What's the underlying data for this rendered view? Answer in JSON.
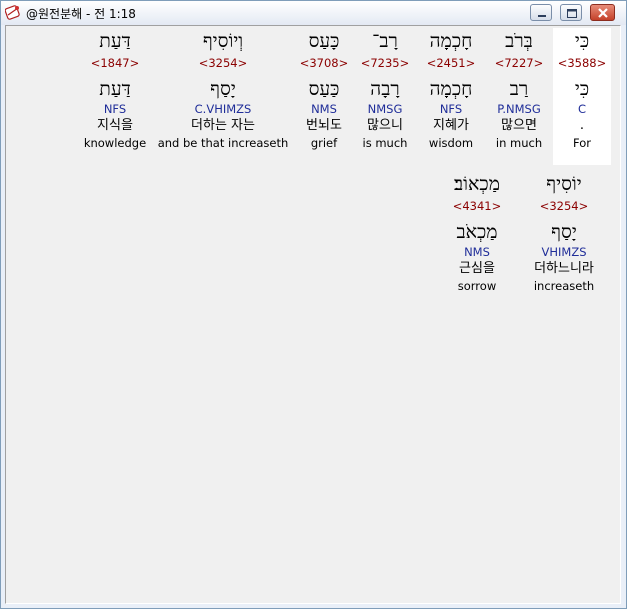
{
  "window": {
    "title": "@원전분해 - 전 1:18"
  },
  "rows": [
    {
      "words": [
        {
          "hebrew": "כִּי",
          "strong": "<3588>",
          "lemma": "כִּי",
          "morph": "C",
          "korean": ".",
          "english": "For",
          "selected": true
        },
        {
          "hebrew": "בְּרֹב",
          "strong": "<7227>",
          "lemma": "רַב",
          "morph": "P.NMSG",
          "korean": "많으면",
          "english": "in much"
        },
        {
          "hebrew": "חָכְמָה",
          "strong": "<2451>",
          "lemma": "חָכְמָה",
          "morph": "NFS",
          "korean": "지혜가",
          "english": "wisdom"
        },
        {
          "hebrew": "רָב־",
          "strong": "<7235>",
          "lemma": "רָבָה",
          "morph": "NMSG",
          "korean": "많으니",
          "english": "is much"
        },
        {
          "hebrew": "כָּעַס",
          "strong": "<3708>",
          "lemma": "כַּעַס",
          "morph": "NMS",
          "korean": "번뇌도",
          "english": "grief"
        },
        {
          "hebrew": "וְיוֹסִיף",
          "strong": "<3254>",
          "lemma": "יָסַף",
          "morph": "C.VHIMZS",
          "korean": "더하는 자는",
          "english": "and be that increaseth"
        },
        {
          "hebrew": "דַּעַת",
          "strong": "<1847>",
          "lemma": "דַּעַת",
          "morph": "NFS",
          "korean": "지식을",
          "english": "knowledge"
        }
      ]
    },
    {
      "words": [
        {
          "hebrew": "יוֹסִיף",
          "strong": "<3254>",
          "lemma": "יָסַף",
          "morph": "VHIMZS",
          "korean": "더하느니라",
          "english": "increaseth"
        },
        {
          "hebrew": "מַכְאוֹב׃",
          "strong": "<4341>",
          "lemma": "מַכְאֹב",
          "morph": "NMS",
          "korean": "근심을",
          "english": "sorrow"
        }
      ]
    }
  ]
}
